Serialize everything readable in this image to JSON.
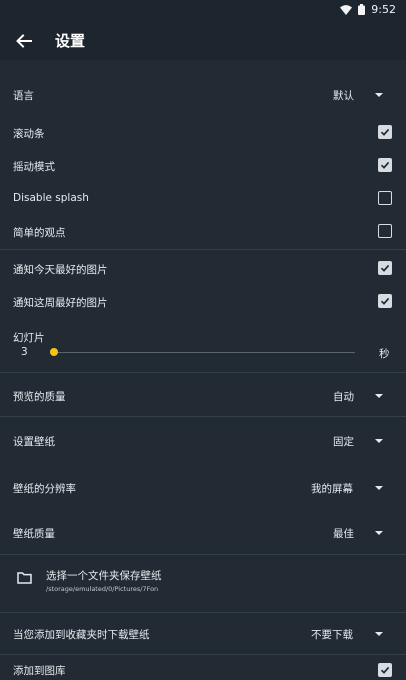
{
  "status": {
    "time": "9:52"
  },
  "toolbar": {
    "title": "设置"
  },
  "settings": {
    "language": {
      "label": "语言",
      "value": "默认"
    },
    "scrollbar": {
      "label": "滚动条",
      "checked": true
    },
    "parallax": {
      "label": "摇动模式",
      "checked": true
    },
    "splash": {
      "label": "Disable splash",
      "checked": false
    },
    "simple_view": {
      "label": "简单的观点",
      "checked": false
    },
    "notify_today": {
      "label": "通知今天最好的图片",
      "checked": true
    },
    "notify_week": {
      "label": "通知这周最好的图片",
      "checked": true
    },
    "slideshow": {
      "label": "幻灯片",
      "value": "3",
      "unit": "秒",
      "level": 0.0
    },
    "preview_quality": {
      "label": "预览的质量",
      "value": "自动"
    },
    "set_wallpaper": {
      "label": "设置壁纸",
      "value": "固定"
    },
    "wallpaper_resolution": {
      "label": "壁纸的分辨率",
      "value": "我的屏幕"
    },
    "wallpaper_quality": {
      "label": "壁纸质量",
      "value": "最佳"
    },
    "save_folder": {
      "label": "选择一个文件夹保存壁纸",
      "path": "/storage/emulated/0/Pictures/7Fon"
    },
    "download_on_fav": {
      "label": "当您添加到收藏夹时下载壁纸",
      "value": "不要下载"
    },
    "add_to_gallery": {
      "label": "添加到图库",
      "checked": true
    }
  }
}
